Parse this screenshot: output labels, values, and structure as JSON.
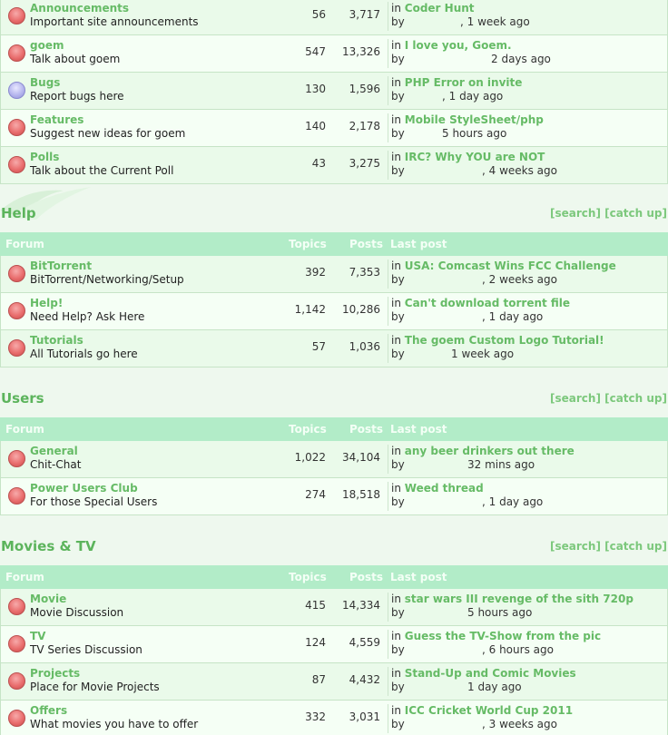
{
  "sections": [
    {
      "id": "general",
      "title": "",
      "links": "",
      "rows": [
        {
          "name": "Announcements",
          "desc": "Important site announcements",
          "topics": "56",
          "posts": "3,717",
          "in": "in",
          "topic": "Coder Hunt",
          "by": "by",
          "ago": ", 1 week ago",
          "icon": "red"
        },
        {
          "name": "goem",
          "desc": "Talk about goem",
          "topics": "547",
          "posts": "13,326",
          "in": "in",
          "topic": "I love you, Goem.",
          "by": "by",
          "ago": "2 days ago",
          "icon": "red"
        },
        {
          "name": "Bugs",
          "desc": "Report bugs here",
          "topics": "130",
          "posts": "1,596",
          "in": "in",
          "topic": "PHP Error on invite",
          "by": "by",
          "ago": ", 1 day ago",
          "icon": "blue"
        },
        {
          "name": "Features",
          "desc": "Suggest new ideas for goem",
          "topics": "140",
          "posts": "2,178",
          "in": "in",
          "topic": "Mobile StyleSheet/php",
          "by": "by",
          "ago": "5 hours ago",
          "icon": "red"
        },
        {
          "name": "Polls",
          "desc": "Talk about the Current Poll",
          "topics": "43",
          "posts": "3,275",
          "in": "in",
          "topic": "IRC? Why YOU are NOT",
          "by": "by",
          "ago": ", 4 weeks ago",
          "icon": "red"
        }
      ]
    },
    {
      "id": "help",
      "title": "Help",
      "links": "[search] [catch up]",
      "rows": [
        {
          "name": "BitTorrent",
          "desc": "BitTorrent/Networking/Setup",
          "topics": "392",
          "posts": "7,353",
          "in": "in",
          "topic": "USA: Comcast Wins FCC Challenge",
          "by": "by",
          "ago": ", 2 weeks ago",
          "icon": "red"
        },
        {
          "name": "Help!",
          "desc": "Need Help? Ask Here",
          "topics": "1,142",
          "posts": "10,286",
          "in": "in",
          "topic": "Can't download torrent file",
          "by": "by",
          "ago": ", 1 day ago",
          "icon": "red"
        },
        {
          "name": "Tutorials",
          "desc": "All Tutorials go here",
          "topics": "57",
          "posts": "1,036",
          "in": "in",
          "topic": "The goem Custom Logo Tutorial!",
          "by": "by",
          "ago": "1 week ago",
          "icon": "red"
        }
      ]
    },
    {
      "id": "users",
      "title": "Users",
      "links": "[search] [catch up]",
      "rows": [
        {
          "name": "General",
          "desc": "Chit-Chat",
          "topics": "1,022",
          "posts": "34,104",
          "in": "in",
          "topic": "any beer drinkers out there",
          "by": "by",
          "ago": "32 mins ago",
          "icon": "red"
        },
        {
          "name": "Power Users Club",
          "desc": "For those Special Users",
          "topics": "274",
          "posts": "18,518",
          "in": "in",
          "topic": "Weed thread",
          "by": "by",
          "ago": ", 1 day ago",
          "icon": "red"
        }
      ]
    },
    {
      "id": "movies",
      "title": "Movies & TV",
      "links": "[search] [catch up]",
      "rows": [
        {
          "name": "Movie",
          "desc": "Movie Discussion",
          "topics": "415",
          "posts": "14,334",
          "in": "in",
          "topic": "star wars III revenge of the sith 720p",
          "by": "by",
          "ago": "5 hours ago",
          "icon": "red"
        },
        {
          "name": "TV",
          "desc": "TV Series Discussion",
          "topics": "124",
          "posts": "4,559",
          "in": "in",
          "topic": "Guess the TV-Show from the pic",
          "by": "by",
          "ago": ", 6 hours ago",
          "icon": "red"
        },
        {
          "name": "Projects",
          "desc": "Place for Movie Projects",
          "topics": "87",
          "posts": "4,432",
          "in": "in",
          "topic": "Stand-Up and Comic Movies",
          "by": "by",
          "ago": "1 day ago",
          "icon": "red"
        },
        {
          "name": "Offers",
          "desc": "What movies you have to offer",
          "topics": "332",
          "posts": "3,031",
          "in": "in",
          "topic": "ICC Cricket World Cup 2011",
          "by": "by",
          "ago": ", 3 weeks ago",
          "icon": "red"
        }
      ]
    }
  ],
  "columns": {
    "forum": "Forum",
    "topics": "Topics",
    "posts": "Posts",
    "last_post": "Last post"
  },
  "colors": {
    "header_bg": "#b2ecc8",
    "link_green": "#66bb66",
    "title_green": "#5cb45c"
  }
}
